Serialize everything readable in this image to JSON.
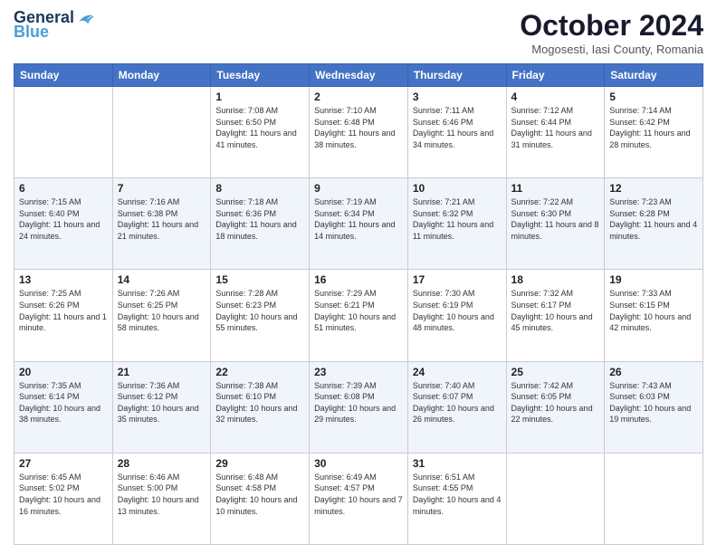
{
  "header": {
    "logo_line1": "General",
    "logo_line2": "Blue",
    "month_title": "October 2024",
    "location": "Mogosesti, Iasi County, Romania"
  },
  "days_of_week": [
    "Sunday",
    "Monday",
    "Tuesday",
    "Wednesday",
    "Thursday",
    "Friday",
    "Saturday"
  ],
  "weeks": [
    [
      {
        "day": "",
        "info": ""
      },
      {
        "day": "",
        "info": ""
      },
      {
        "day": "1",
        "info": "Sunrise: 7:08 AM\nSunset: 6:50 PM\nDaylight: 11 hours and 41 minutes."
      },
      {
        "day": "2",
        "info": "Sunrise: 7:10 AM\nSunset: 6:48 PM\nDaylight: 11 hours and 38 minutes."
      },
      {
        "day": "3",
        "info": "Sunrise: 7:11 AM\nSunset: 6:46 PM\nDaylight: 11 hours and 34 minutes."
      },
      {
        "day": "4",
        "info": "Sunrise: 7:12 AM\nSunset: 6:44 PM\nDaylight: 11 hours and 31 minutes."
      },
      {
        "day": "5",
        "info": "Sunrise: 7:14 AM\nSunset: 6:42 PM\nDaylight: 11 hours and 28 minutes."
      }
    ],
    [
      {
        "day": "6",
        "info": "Sunrise: 7:15 AM\nSunset: 6:40 PM\nDaylight: 11 hours and 24 minutes."
      },
      {
        "day": "7",
        "info": "Sunrise: 7:16 AM\nSunset: 6:38 PM\nDaylight: 11 hours and 21 minutes."
      },
      {
        "day": "8",
        "info": "Sunrise: 7:18 AM\nSunset: 6:36 PM\nDaylight: 11 hours and 18 minutes."
      },
      {
        "day": "9",
        "info": "Sunrise: 7:19 AM\nSunset: 6:34 PM\nDaylight: 11 hours and 14 minutes."
      },
      {
        "day": "10",
        "info": "Sunrise: 7:21 AM\nSunset: 6:32 PM\nDaylight: 11 hours and 11 minutes."
      },
      {
        "day": "11",
        "info": "Sunrise: 7:22 AM\nSunset: 6:30 PM\nDaylight: 11 hours and 8 minutes."
      },
      {
        "day": "12",
        "info": "Sunrise: 7:23 AM\nSunset: 6:28 PM\nDaylight: 11 hours and 4 minutes."
      }
    ],
    [
      {
        "day": "13",
        "info": "Sunrise: 7:25 AM\nSunset: 6:26 PM\nDaylight: 11 hours and 1 minute."
      },
      {
        "day": "14",
        "info": "Sunrise: 7:26 AM\nSunset: 6:25 PM\nDaylight: 10 hours and 58 minutes."
      },
      {
        "day": "15",
        "info": "Sunrise: 7:28 AM\nSunset: 6:23 PM\nDaylight: 10 hours and 55 minutes."
      },
      {
        "day": "16",
        "info": "Sunrise: 7:29 AM\nSunset: 6:21 PM\nDaylight: 10 hours and 51 minutes."
      },
      {
        "day": "17",
        "info": "Sunrise: 7:30 AM\nSunset: 6:19 PM\nDaylight: 10 hours and 48 minutes."
      },
      {
        "day": "18",
        "info": "Sunrise: 7:32 AM\nSunset: 6:17 PM\nDaylight: 10 hours and 45 minutes."
      },
      {
        "day": "19",
        "info": "Sunrise: 7:33 AM\nSunset: 6:15 PM\nDaylight: 10 hours and 42 minutes."
      }
    ],
    [
      {
        "day": "20",
        "info": "Sunrise: 7:35 AM\nSunset: 6:14 PM\nDaylight: 10 hours and 38 minutes."
      },
      {
        "day": "21",
        "info": "Sunrise: 7:36 AM\nSunset: 6:12 PM\nDaylight: 10 hours and 35 minutes."
      },
      {
        "day": "22",
        "info": "Sunrise: 7:38 AM\nSunset: 6:10 PM\nDaylight: 10 hours and 32 minutes."
      },
      {
        "day": "23",
        "info": "Sunrise: 7:39 AM\nSunset: 6:08 PM\nDaylight: 10 hours and 29 minutes."
      },
      {
        "day": "24",
        "info": "Sunrise: 7:40 AM\nSunset: 6:07 PM\nDaylight: 10 hours and 26 minutes."
      },
      {
        "day": "25",
        "info": "Sunrise: 7:42 AM\nSunset: 6:05 PM\nDaylight: 10 hours and 22 minutes."
      },
      {
        "day": "26",
        "info": "Sunrise: 7:43 AM\nSunset: 6:03 PM\nDaylight: 10 hours and 19 minutes."
      }
    ],
    [
      {
        "day": "27",
        "info": "Sunrise: 6:45 AM\nSunset: 5:02 PM\nDaylight: 10 hours and 16 minutes."
      },
      {
        "day": "28",
        "info": "Sunrise: 6:46 AM\nSunset: 5:00 PM\nDaylight: 10 hours and 13 minutes."
      },
      {
        "day": "29",
        "info": "Sunrise: 6:48 AM\nSunset: 4:58 PM\nDaylight: 10 hours and 10 minutes."
      },
      {
        "day": "30",
        "info": "Sunrise: 6:49 AM\nSunset: 4:57 PM\nDaylight: 10 hours and 7 minutes."
      },
      {
        "day": "31",
        "info": "Sunrise: 6:51 AM\nSunset: 4:55 PM\nDaylight: 10 hours and 4 minutes."
      },
      {
        "day": "",
        "info": ""
      },
      {
        "day": "",
        "info": ""
      }
    ]
  ]
}
